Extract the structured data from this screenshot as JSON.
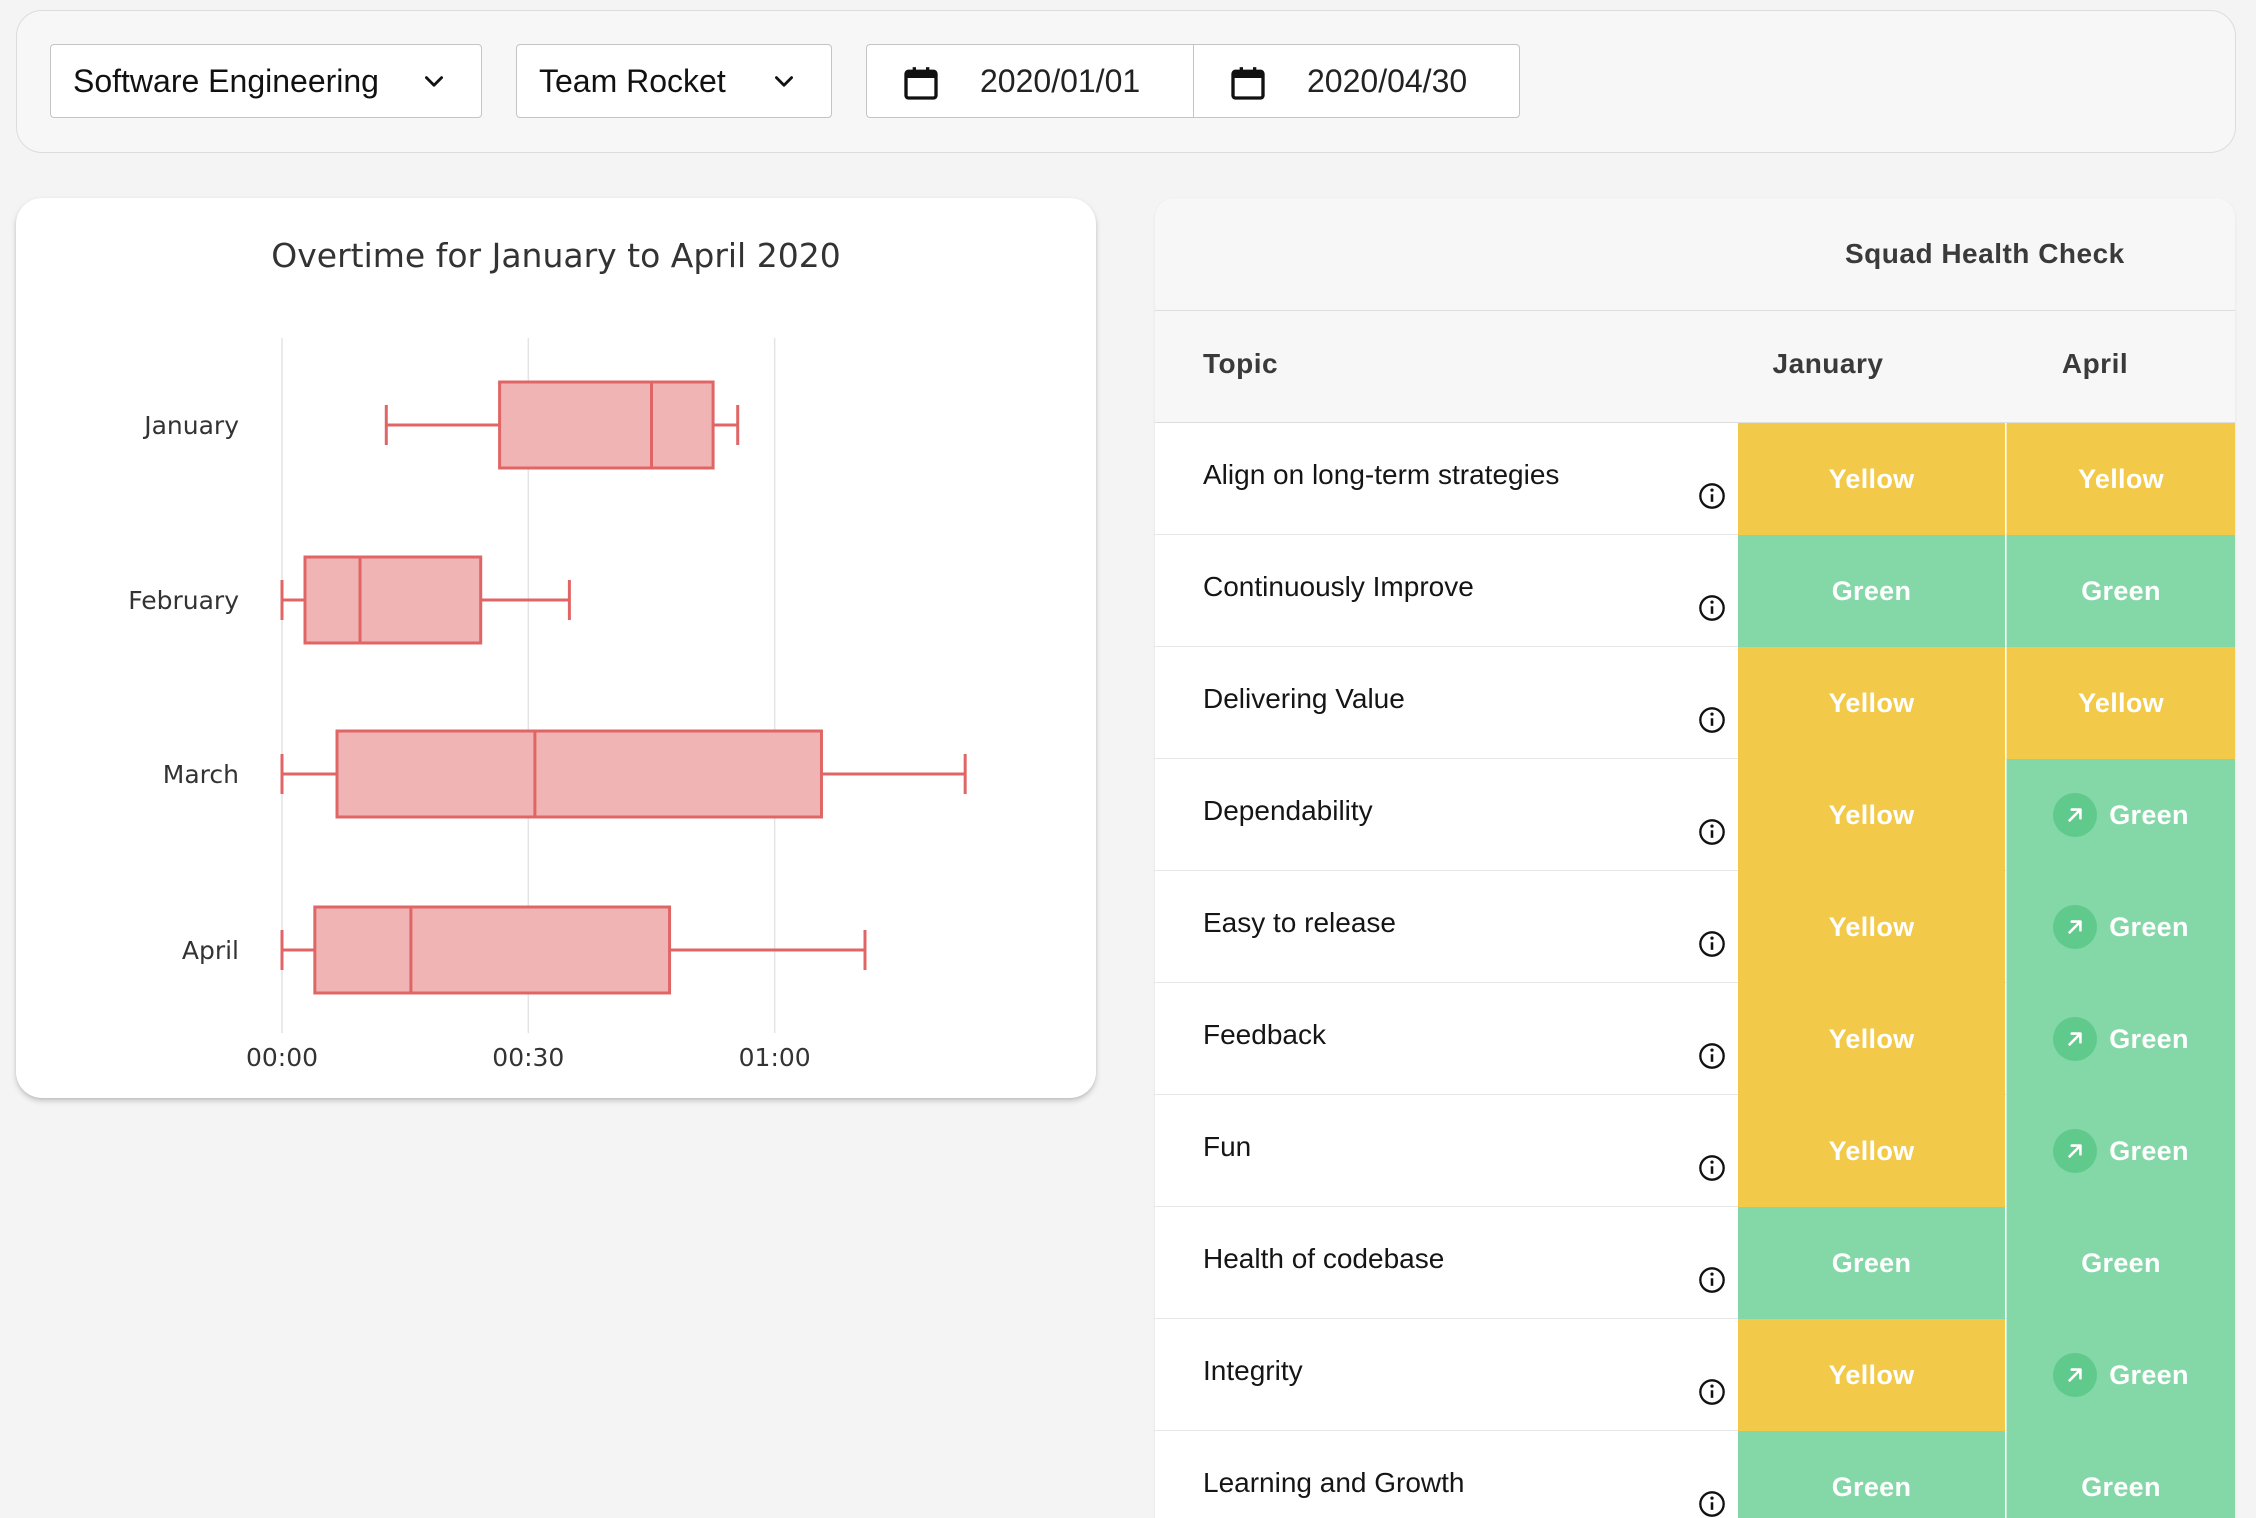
{
  "filters": {
    "department": "Software Engineering",
    "team": "Team Rocket",
    "start_date": "2020/01/01",
    "end_date": "2020/04/30"
  },
  "icons": {
    "dropdown": "chevron-down-icon",
    "date": "calendar-icon",
    "info": "info-icon",
    "trend": "arrow-up-right-icon"
  },
  "colors": {
    "Yellow": "#f3c94a",
    "Green": "#84d8a8",
    "box_fill": "#f0b4b4",
    "box_stroke": "#e06666"
  },
  "chart_data": {
    "type": "box",
    "orientation": "horizontal",
    "title": "Overtime for January to April 2020",
    "xticks": [
      "00:00",
      "00:30",
      "01:00"
    ],
    "xlim_minutes": [
      0,
      90
    ],
    "series": [
      {
        "category": "January",
        "min": 12.7,
        "q1": 26.5,
        "median": 45.0,
        "q3": 52.5,
        "max": 55.5
      },
      {
        "category": "February",
        "min": 0.0,
        "q1": 2.8,
        "median": 9.5,
        "q3": 24.2,
        "max": 35.0
      },
      {
        "category": "March",
        "min": 0.0,
        "q1": 6.7,
        "median": 30.8,
        "q3": 65.7,
        "max": 83.2
      },
      {
        "category": "April",
        "min": 0.0,
        "q1": 4.0,
        "median": 15.7,
        "q3": 47.2,
        "max": 71.0
      }
    ],
    "grid": true
  },
  "health": {
    "title": "Squad Health Check",
    "columns": {
      "topic": "Topic",
      "first": "January",
      "second": "April"
    },
    "rows": [
      {
        "topic": "Align on long-term strategies",
        "jan": "Yellow",
        "apr": "Yellow",
        "trend": false
      },
      {
        "topic": "Continuously Improve",
        "jan": "Green",
        "apr": "Green",
        "trend": false
      },
      {
        "topic": "Delivering Value",
        "jan": "Yellow",
        "apr": "Yellow",
        "trend": false
      },
      {
        "topic": "Dependability",
        "jan": "Yellow",
        "apr": "Green",
        "trend": true
      },
      {
        "topic": "Easy to release",
        "jan": "Yellow",
        "apr": "Green",
        "trend": true
      },
      {
        "topic": "Feedback",
        "jan": "Yellow",
        "apr": "Green",
        "trend": true
      },
      {
        "topic": "Fun",
        "jan": "Yellow",
        "apr": "Green",
        "trend": true
      },
      {
        "topic": "Health of codebase",
        "jan": "Green",
        "apr": "Green",
        "trend": false
      },
      {
        "topic": "Integrity",
        "jan": "Yellow",
        "apr": "Green",
        "trend": true
      },
      {
        "topic": "Learning and Growth",
        "jan": "Green",
        "apr": "Green",
        "trend": false
      }
    ]
  }
}
